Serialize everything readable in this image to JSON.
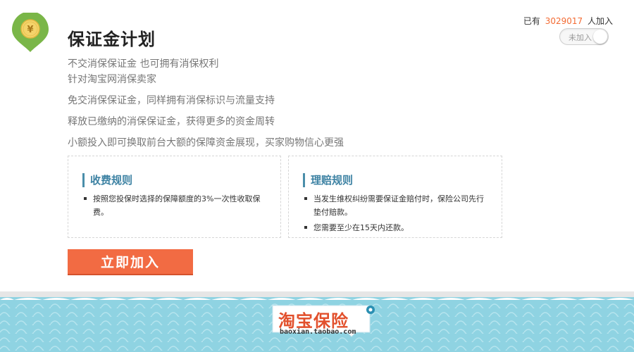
{
  "header": {
    "title": "保证金计划",
    "join_prefix": "已有",
    "join_count": "3029017",
    "join_suffix": "人加入",
    "toggle_label": "未加入"
  },
  "description": {
    "line1": "不交消保保证金 也可拥有消保权利",
    "line2": "针对淘宝网消保卖家",
    "line3": "免交消保保证金，同样拥有消保标识与流量支持",
    "line4": "释放已缴纳的消保保证金，获得更多的资金周转",
    "line5": "小额投入即可换取前台大额的保障资金展现，买家购物信心更强"
  },
  "fee_rules": {
    "title": "收费规则",
    "items": [
      "按照您投保时选择的保障额度的3%一次性收取保费。"
    ]
  },
  "claim_rules": {
    "title": "理赔规则",
    "items": [
      "当发生维权纠纷需要保证金赔付时，保险公司先行垫付赔款。",
      "您需要至少在15天内还款。"
    ]
  },
  "join_button": "立即加入",
  "brand": {
    "name": "淘宝保险",
    "url": "baoxian.taobao.com"
  },
  "icons": {
    "badge": "yen-coin-location-icon",
    "pin": "location-pin-icon"
  },
  "colors": {
    "accent": "#f26b43",
    "count": "#f36b33",
    "rule_title": "#3d82a3",
    "badge_green": "#7ab648",
    "badge_gold": "#f4d36a",
    "footer_blue": "#8fd3e2"
  }
}
